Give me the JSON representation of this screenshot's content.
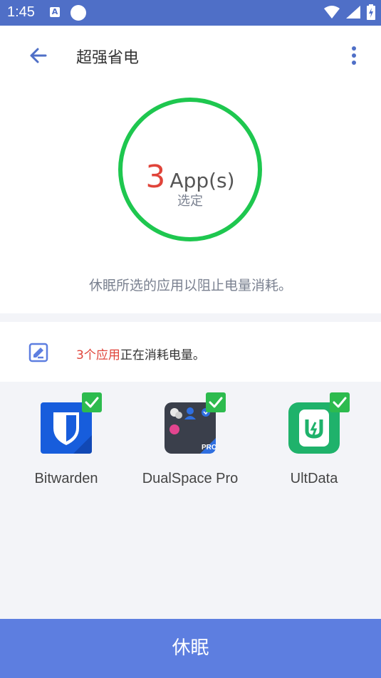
{
  "status_bar": {
    "time": "1:45",
    "notification_icon": "A",
    "icons": [
      "wifi-icon",
      "signal-icon",
      "battery-charging-icon"
    ],
    "color": "#4f6fc7"
  },
  "app_bar": {
    "back_icon": "arrow-left-icon",
    "title": "超强省电",
    "more_icon": "more-vertical-icon"
  },
  "summary": {
    "count": "3",
    "unit": "App(s)",
    "subtitle": "选定",
    "description": "休眠所选的应用以阻止电量消耗。",
    "ring_color": "#1ec74f"
  },
  "notice": {
    "icon": "battery-edit-icon",
    "highlight": "3个应用",
    "text": "正在消耗电量。",
    "highlight_color": "#e0443a"
  },
  "apps": [
    {
      "label": "Bitwarden",
      "selected": true,
      "icon": "shield-icon"
    },
    {
      "label": "DualSpace Pro",
      "selected": true,
      "icon": "dualspace-icon",
      "badge": "PRO"
    },
    {
      "label": "UltData",
      "selected": true,
      "icon": "ultdata-icon"
    }
  ],
  "action_button": {
    "label": "休眠",
    "color": "#5d7ee0"
  }
}
